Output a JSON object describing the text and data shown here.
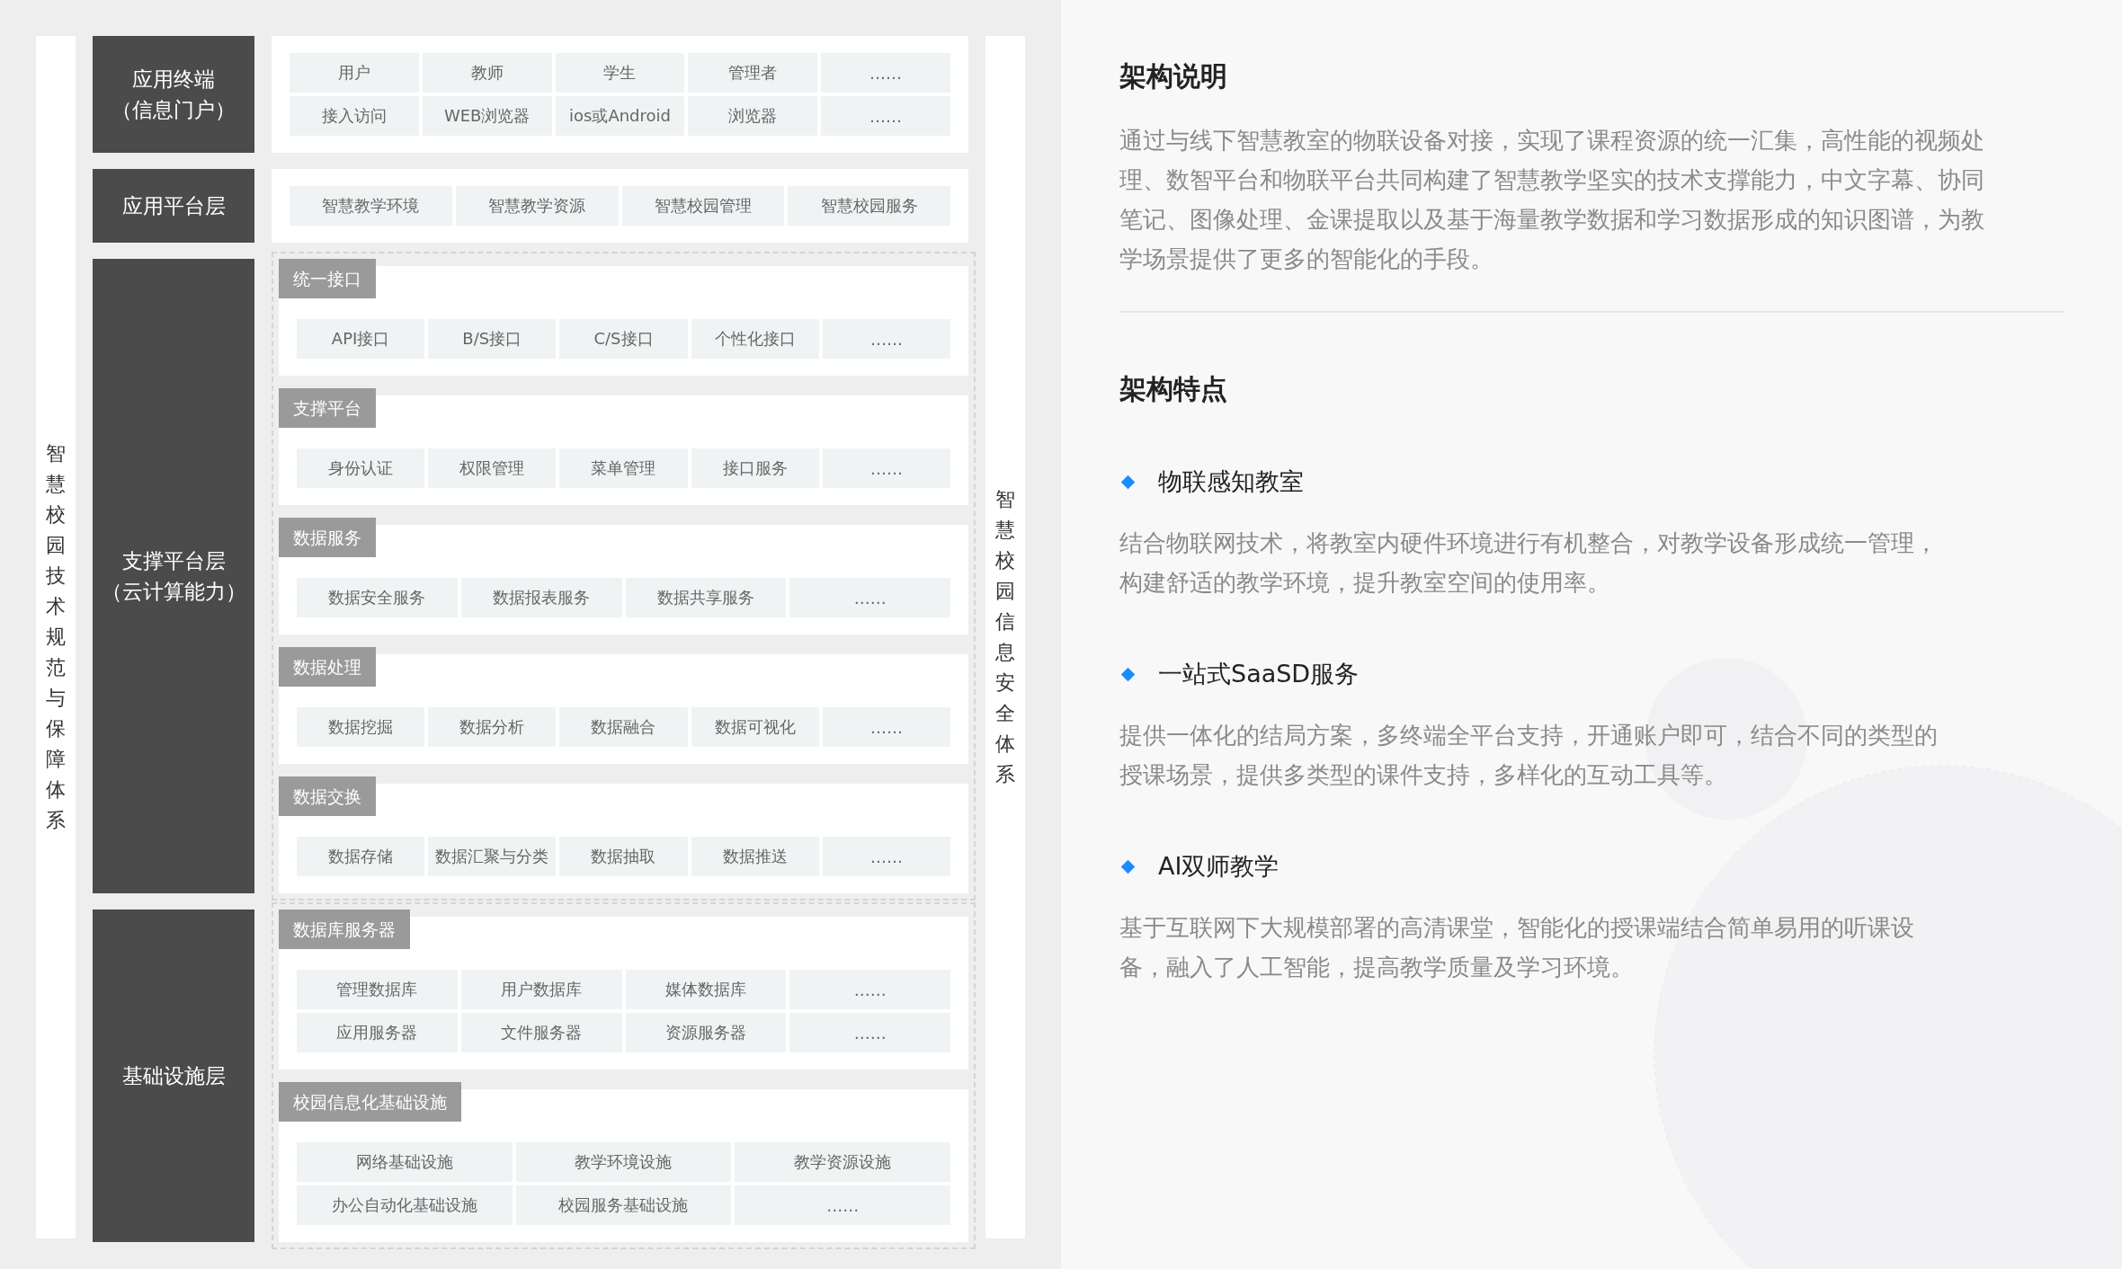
{
  "left_band": {
    "text": "智慧校园技术规范与保障体系"
  },
  "right_band": {
    "text": "智慧校园信息安全体系"
  },
  "layers": [
    {
      "label_lines": [
        "应用终端",
        "（信息门户）"
      ],
      "dashed": false,
      "groups": [
        {
          "rows": [
            [
              "用户",
              "教师",
              "学生",
              "管理者",
              "……"
            ],
            [
              "接入访问",
              "WEB浏览器",
              "ios或Android",
              "浏览器",
              "……"
            ]
          ]
        }
      ]
    },
    {
      "label_lines": [
        "应用平台层"
      ],
      "dashed": false,
      "groups": [
        {
          "rows": [
            [
              "智慧教学环境",
              "智慧教学资源",
              "智慧校园管理",
              "智慧校园服务"
            ]
          ]
        }
      ]
    },
    {
      "label_lines": [
        "支撑平台层",
        "（云计算能力）"
      ],
      "dashed": true,
      "groups": [
        {
          "tag": "统一接口",
          "rows": [
            [
              "API接口",
              "B/S接口",
              "C/S接口",
              "个性化接口",
              "……"
            ]
          ]
        },
        {
          "tag": "支撑平台",
          "rows": [
            [
              "身份认证",
              "权限管理",
              "菜单管理",
              "接口服务",
              "……"
            ]
          ]
        },
        {
          "tag": "数据服务",
          "rows": [
            [
              "数据安全服务",
              "数据报表服务",
              "数据共享服务",
              "……"
            ]
          ]
        },
        {
          "tag": "数据处理",
          "rows": [
            [
              "数据挖掘",
              "数据分析",
              "数据融合",
              "数据可视化",
              "……"
            ]
          ]
        },
        {
          "tag": "数据交换",
          "rows": [
            [
              "数据存储",
              "数据汇聚与分类",
              "数据抽取",
              "数据推送",
              "……"
            ]
          ]
        }
      ]
    },
    {
      "label_lines": [
        "基础设施层"
      ],
      "dashed": true,
      "groups": [
        {
          "tag": "数据库服务器",
          "rows": [
            [
              "管理数据库",
              "用户数据库",
              "媒体数据库",
              "……"
            ],
            [
              "应用服务器",
              "文件服务器",
              "资源服务器",
              "……"
            ]
          ]
        },
        {
          "tag": "校园信息化基础设施",
          "rows": [
            [
              "网络基础设施",
              "教学环境设施",
              "教学资源设施"
            ],
            [
              "办公自动化基础设施",
              "校园服务基础设施",
              "……"
            ]
          ]
        }
      ]
    }
  ],
  "description": {
    "title": "架构说明",
    "lines": [
      "通过与线下智慧教室的物联设备对接，实现了课程资源的统一汇集，高性能的视频处",
      "理、数智平台和物联平台共同构建了智慧教学坚实的技术支撑能力，中文字幕、协同",
      "笔记、图像处理、金课提取以及基于海量教学数据和学习数据形成的知识图谱，为教",
      "学场景提供了更多的智能化的手段。"
    ]
  },
  "features": {
    "title": "架构特点",
    "items": [
      {
        "title": "物联感知教室",
        "lines": [
          "结合物联网技术，将教室内硬件环境进行有机整合，对教学设备形成统一管理，",
          "构建舒适的教学环境，提升教室空间的使用率。"
        ]
      },
      {
        "title": "一站式SaaSD服务",
        "lines": [
          "提供一体化的结局方案，多终端全平台支持，开通账户即可，结合不同的类型的",
          "授课场景，提供多类型的课件支持，多样化的互动工具等。"
        ]
      },
      {
        "title": "AI双师教学",
        "lines": [
          "基于互联网下大规模部署的高清课堂，智能化的授课端结合简单易用的听课设",
          "备，融入了人工智能，提高教学质量及学习环境。"
        ]
      }
    ]
  }
}
